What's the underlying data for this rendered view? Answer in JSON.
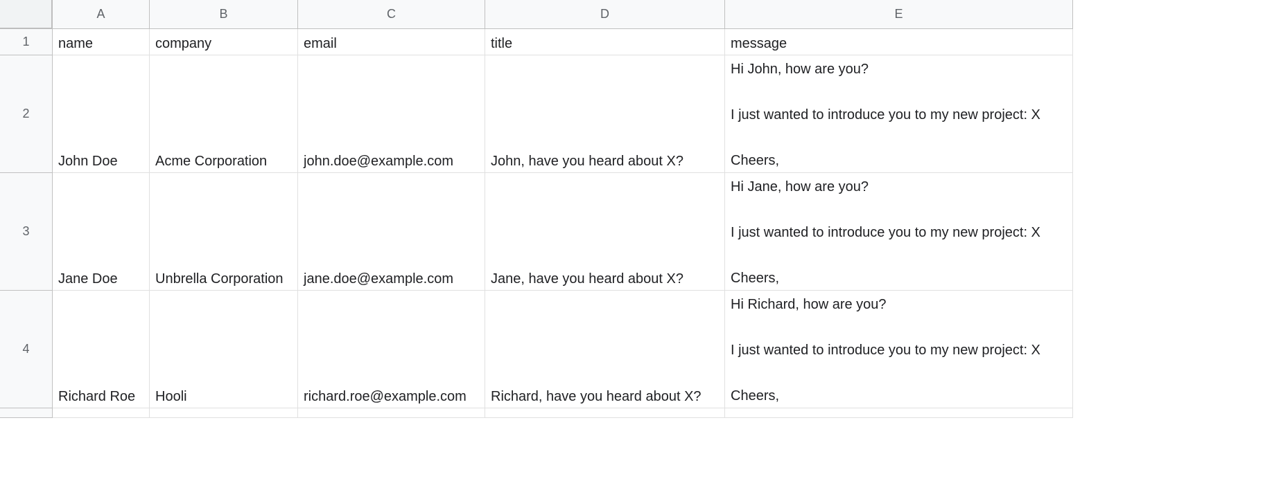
{
  "columns": [
    "A",
    "B",
    "C",
    "D",
    "E"
  ],
  "rowNumbers": [
    "1",
    "2",
    "3",
    "4"
  ],
  "header": {
    "A": "name",
    "B": "company",
    "C": "email",
    "D": "title",
    "E": "message"
  },
  "rows": [
    {
      "A": "John Doe",
      "B": "Acme Corporation",
      "C": "john.doe@example.com",
      "D": "John, have you heard about X?",
      "E": "Hi John, how are you?\n\nI just wanted to introduce you to my new project: X\n\nCheers,\nDamien"
    },
    {
      "A": "Jane Doe",
      "B": "Unbrella Corporation",
      "C": "jane.doe@example.com",
      "D": "Jane, have you heard about X?",
      "E": "Hi Jane, how are you?\n\nI just wanted to introduce you to my new project: X\n\nCheers,\nDamien"
    },
    {
      "A": "Richard Roe",
      "B": "Hooli",
      "C": "richard.roe@example.com",
      "D": "Richard, have you heard about X?",
      "E": "Hi Richard, how are you?\n\nI just wanted to introduce you to my new project: X\n\nCheers,\nDamien"
    }
  ]
}
